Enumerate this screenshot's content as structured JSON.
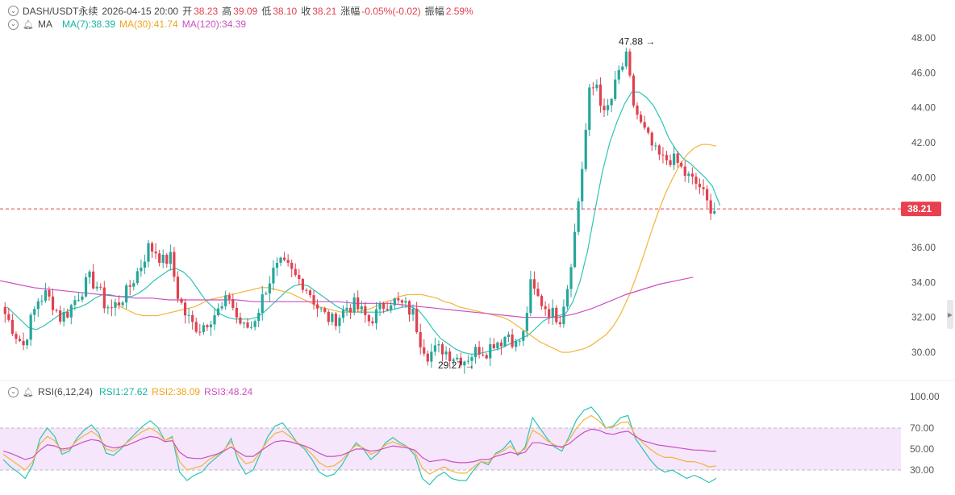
{
  "header": {
    "symbol": "DASH/USDT永续",
    "datetime": "2026-04-15 20:00",
    "open_label": "开",
    "open_value": "38.23",
    "high_label": "高",
    "high_value": "39.09",
    "low_label": "低",
    "low_value": "38.10",
    "close_label": "收",
    "close_value": "38.21",
    "change_label": "涨幅",
    "change_value": "-0.05%(-0.02)",
    "amplitude_label": "振幅",
    "amplitude_value": "2.59%"
  },
  "ma_legend": {
    "label": "MA",
    "ma7": "MA(7):38.39",
    "ma30": "MA(30):41.74",
    "ma120": "MA(120):34.39"
  },
  "rsi_legend": {
    "label": "RSI(6,12,24)",
    "rsi1": "RSI1:27.62",
    "rsi2": "RSI2:38.09",
    "rsi3": "RSI3:48.24"
  },
  "colors": {
    "up": "#26a69a",
    "down": "#e0414f",
    "ma7": "#2ec4b4",
    "ma30": "#f3b43c",
    "ma120": "#cc4fc4",
    "rsi_band": "#f5e6fb",
    "price_tag": "#e8404f"
  },
  "chart_data": [
    {
      "type": "candlestick",
      "y_axis_labels": [
        "48.00",
        "46.00",
        "44.00",
        "42.00",
        "40.00",
        "38.21",
        "36.00",
        "34.00",
        "32.00",
        "30.00"
      ],
      "ylim": [
        29.0,
        48.3
      ],
      "y_ticks": [
        48,
        46,
        44,
        42,
        40,
        36,
        34,
        32,
        30
      ],
      "current_price": 38.21,
      "current_price_label": "38.21",
      "high_marker": {
        "value": 47.88,
        "label": "47.88 →"
      },
      "low_marker": {
        "value": 29.27,
        "label": "← 29.27"
      },
      "price_path": [
        32.6,
        31.8,
        31.0,
        30.4,
        31.8,
        33.0,
        33.3,
        32.8,
        32.0,
        32.3,
        33.0,
        33.6,
        34.2,
        33.8,
        32.8,
        32.5,
        32.9,
        33.4,
        34.2,
        35.0,
        36.0,
        35.8,
        35.2,
        35.4,
        33.3,
        32.2,
        31.6,
        31.4,
        31.8,
        32.2,
        32.5,
        33.2,
        32.0,
        31.4,
        31.5,
        32.5,
        33.7,
        34.6,
        35.0,
        34.8,
        34.3,
        34.0,
        33.4,
        32.6,
        32.1,
        31.8,
        32.1,
        32.6,
        32.7,
        32.3,
        31.8,
        32.2,
        32.7,
        33.0,
        32.8,
        32.6,
        32.2,
        30.7,
        29.9,
        30.1,
        30.2,
        29.9,
        29.7,
        29.6,
        29.9,
        30.2,
        30.1,
        30.6,
        30.7,
        31.1,
        30.4,
        31.0,
        33.8,
        33.1,
        32.6,
        32.2,
        32.0,
        33.8,
        36.8,
        40.6,
        44.8,
        45.4,
        43.5,
        44.5,
        46.0,
        46.8,
        44.2,
        43.0,
        42.2,
        41.4,
        41.0,
        41.1,
        40.8,
        40.2,
        39.8,
        39.5,
        38.5,
        38.2
      ],
      "ma7": [
        32.6,
        32.2,
        31.8,
        31.4,
        31.3,
        31.5,
        31.8,
        32.1,
        32.3,
        32.5,
        32.6,
        32.8,
        33.1,
        33.3,
        33.3,
        33.2,
        33.2,
        33.2,
        33.4,
        33.7,
        34.1,
        34.4,
        34.7,
        34.8,
        34.6,
        34.2,
        33.6,
        33.0,
        32.6,
        32.2,
        32.0,
        31.9,
        31.9,
        31.9,
        32.0,
        32.3,
        32.7,
        33.1,
        33.5,
        33.8,
        33.9,
        33.8,
        33.5,
        33.2,
        32.9,
        32.6,
        32.4,
        32.3,
        32.3,
        32.3,
        32.3,
        32.3,
        32.4,
        32.5,
        32.6,
        32.6,
        32.4,
        31.9,
        31.3,
        30.8,
        30.5,
        30.2,
        30.0,
        29.9,
        29.9,
        30.0,
        30.1,
        30.2,
        30.4,
        30.6,
        30.8,
        31.0,
        31.4,
        31.8,
        32.0,
        32.1,
        32.2,
        32.9,
        34.1,
        35.8,
        38.1,
        40.3,
        42.0,
        43.2,
        44.2,
        44.9,
        44.9,
        44.6,
        44.1,
        43.3,
        42.3,
        41.6,
        41.1,
        40.8,
        40.4,
        40.0,
        39.5,
        38.4
      ],
      "ma30": [
        32.9,
        32.6,
        32.4,
        32.2,
        32.1,
        32.1,
        32.1,
        32.2,
        32.3,
        32.4,
        32.5,
        32.6,
        32.8,
        33.0,
        33.1,
        33.2,
        33.3,
        33.4,
        33.5,
        33.6,
        33.7,
        33.7,
        33.6,
        33.5,
        33.4,
        33.2,
        33.0,
        32.8,
        32.6,
        32.5,
        32.4,
        32.3,
        32.3,
        32.3,
        32.4,
        32.5,
        32.7,
        32.9,
        33.0,
        33.2,
        33.3,
        33.3,
        33.3,
        33.2,
        33.1,
        32.9,
        32.8,
        32.6,
        32.5,
        32.4,
        32.3,
        32.2,
        32.1,
        32.0,
        31.8,
        31.5,
        31.2,
        30.9,
        30.6,
        30.4,
        30.2,
        30.0,
        30.0,
        30.1,
        30.2,
        30.4,
        30.7,
        31.0,
        31.5,
        32.2,
        33.1,
        34.2,
        35.4,
        36.7,
        37.9,
        39.0,
        39.9,
        40.7,
        41.3,
        41.7,
        41.9,
        41.9,
        41.8
      ],
      "ma30_offset": 15,
      "ma120": [
        34.1,
        33.9,
        33.7,
        33.6,
        33.5,
        33.4,
        33.3,
        33.2,
        33.1,
        33.1,
        33.0,
        33.0,
        33.0,
        33.0,
        33.0,
        32.9,
        32.9,
        32.9,
        32.9,
        32.9,
        32.9,
        32.8,
        32.8,
        32.8,
        32.7,
        32.6,
        32.5,
        32.4,
        32.3,
        32.2,
        32.1,
        32.0,
        32.0,
        32.0,
        32.2,
        32.5,
        32.9,
        33.3,
        33.6,
        33.9,
        34.1,
        34.3
      ],
      "ma120_step": 2.3
    },
    {
      "type": "line",
      "title": "RSI(6,12,24)",
      "y_axis_labels": [
        "100.00",
        "70.00",
        "50.00",
        "30.00"
      ],
      "ylim": [
        20,
        100
      ],
      "y_ticks": [
        100,
        70,
        50,
        30
      ],
      "band": [
        30,
        70
      ],
      "series": [
        {
          "name": "RSI1",
          "values": [
            40,
            33,
            28,
            22,
            35,
            60,
            70,
            62,
            45,
            48,
            60,
            68,
            73,
            65,
            46,
            44,
            50,
            58,
            65,
            72,
            77,
            71,
            58,
            62,
            28,
            20,
            25,
            28,
            36,
            42,
            48,
            60,
            38,
            26,
            30,
            46,
            62,
            72,
            75,
            66,
            56,
            50,
            40,
            28,
            24,
            26,
            34,
            46,
            56,
            50,
            40,
            46,
            56,
            61,
            56,
            52,
            44,
            22,
            16,
            24,
            28,
            22,
            20,
            20,
            30,
            38,
            35,
            46,
            50,
            58,
            44,
            52,
            80,
            70,
            60,
            52,
            48,
            62,
            78,
            87,
            90,
            82,
            70,
            72,
            80,
            82,
            60,
            50,
            40,
            32,
            28,
            30,
            26,
            22,
            25,
            22,
            18,
            22
          ]
        },
        {
          "name": "RSI2",
          "values": [
            45,
            40,
            35,
            30,
            38,
            55,
            62,
            58,
            48,
            50,
            58,
            63,
            67,
            62,
            50,
            48,
            52,
            57,
            62,
            67,
            70,
            66,
            58,
            61,
            38,
            30,
            32,
            34,
            40,
            44,
            49,
            57,
            44,
            36,
            38,
            48,
            58,
            65,
            67,
            62,
            56,
            52,
            45,
            37,
            33,
            34,
            39,
            47,
            54,
            51,
            45,
            48,
            54,
            57,
            54,
            52,
            47,
            32,
            26,
            30,
            33,
            29,
            27,
            27,
            33,
            38,
            37,
            45,
            48,
            53,
            46,
            50,
            68,
            64,
            58,
            54,
            51,
            59,
            70,
            78,
            82,
            77,
            70,
            71,
            75,
            76,
            63,
            56,
            50,
            45,
            42,
            42,
            40,
            38,
            38,
            36,
            33,
            34
          ]
        },
        {
          "name": "RSI3",
          "values": [
            48,
            46,
            43,
            40,
            42,
            49,
            54,
            53,
            50,
            51,
            54,
            57,
            59,
            58,
            53,
            51,
            52,
            54,
            57,
            60,
            62,
            61,
            57,
            58,
            47,
            42,
            41,
            41,
            43,
            45,
            48,
            52,
            47,
            43,
            43,
            48,
            53,
            57,
            58,
            57,
            55,
            53,
            50,
            46,
            43,
            43,
            44,
            47,
            50,
            50,
            48,
            49,
            51,
            53,
            52,
            51,
            49,
            42,
            38,
            39,
            40,
            38,
            37,
            37,
            38,
            40,
            40,
            43,
            45,
            47,
            45,
            47,
            56,
            56,
            54,
            53,
            52,
            55,
            61,
            66,
            69,
            68,
            65,
            64,
            66,
            67,
            62,
            58,
            56,
            54,
            53,
            52,
            51,
            50,
            49,
            49,
            48,
            48
          ]
        }
      ]
    }
  ]
}
